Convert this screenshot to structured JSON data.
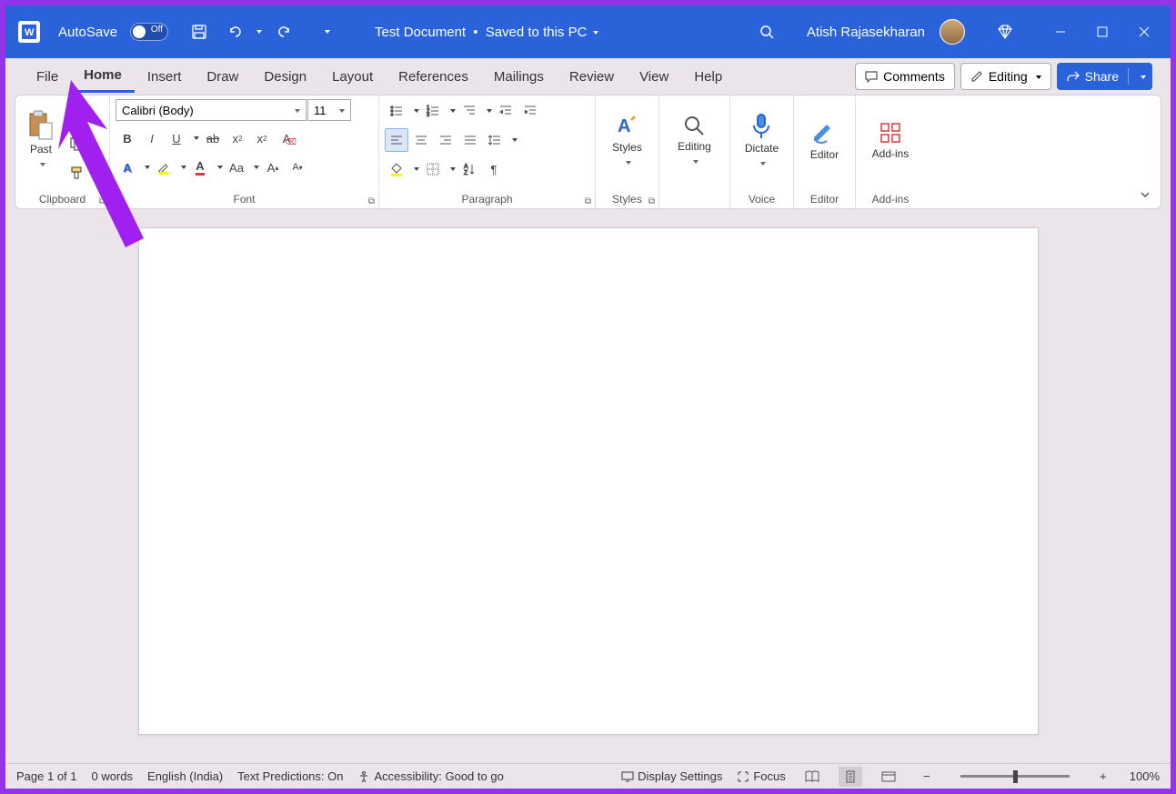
{
  "titlebar": {
    "autosave_label": "AutoSave",
    "autosave_state": "Off",
    "doc_title": "Test Document",
    "save_status": "Saved to this PC",
    "user_name": "Atish Rajasekharan"
  },
  "tabs": {
    "items": [
      "File",
      "Home",
      "Insert",
      "Draw",
      "Design",
      "Layout",
      "References",
      "Mailings",
      "Review",
      "View",
      "Help"
    ],
    "active": "Home",
    "comments": "Comments",
    "editing": "Editing",
    "share": "Share"
  },
  "ribbon": {
    "clipboard": {
      "paste": "Past",
      "label": "Clipboard"
    },
    "font": {
      "name": "Calibri (Body)",
      "size": "11",
      "label": "Font"
    },
    "paragraph": {
      "label": "Paragraph"
    },
    "styles": {
      "btn": "Styles",
      "label": "Styles"
    },
    "editing": {
      "btn": "Editing"
    },
    "dictate": {
      "btn": "Dictate",
      "label": "Voice"
    },
    "editor": {
      "btn": "Editor",
      "label": "Editor"
    },
    "addins": {
      "btn": "Add-ins",
      "label": "Add-ins"
    }
  },
  "statusbar": {
    "page": "Page 1 of 1",
    "words": "0 words",
    "lang": "English (India)",
    "predictions": "Text Predictions: On",
    "accessibility": "Accessibility: Good to go",
    "display": "Display Settings",
    "focus": "Focus",
    "zoom": "100%"
  }
}
